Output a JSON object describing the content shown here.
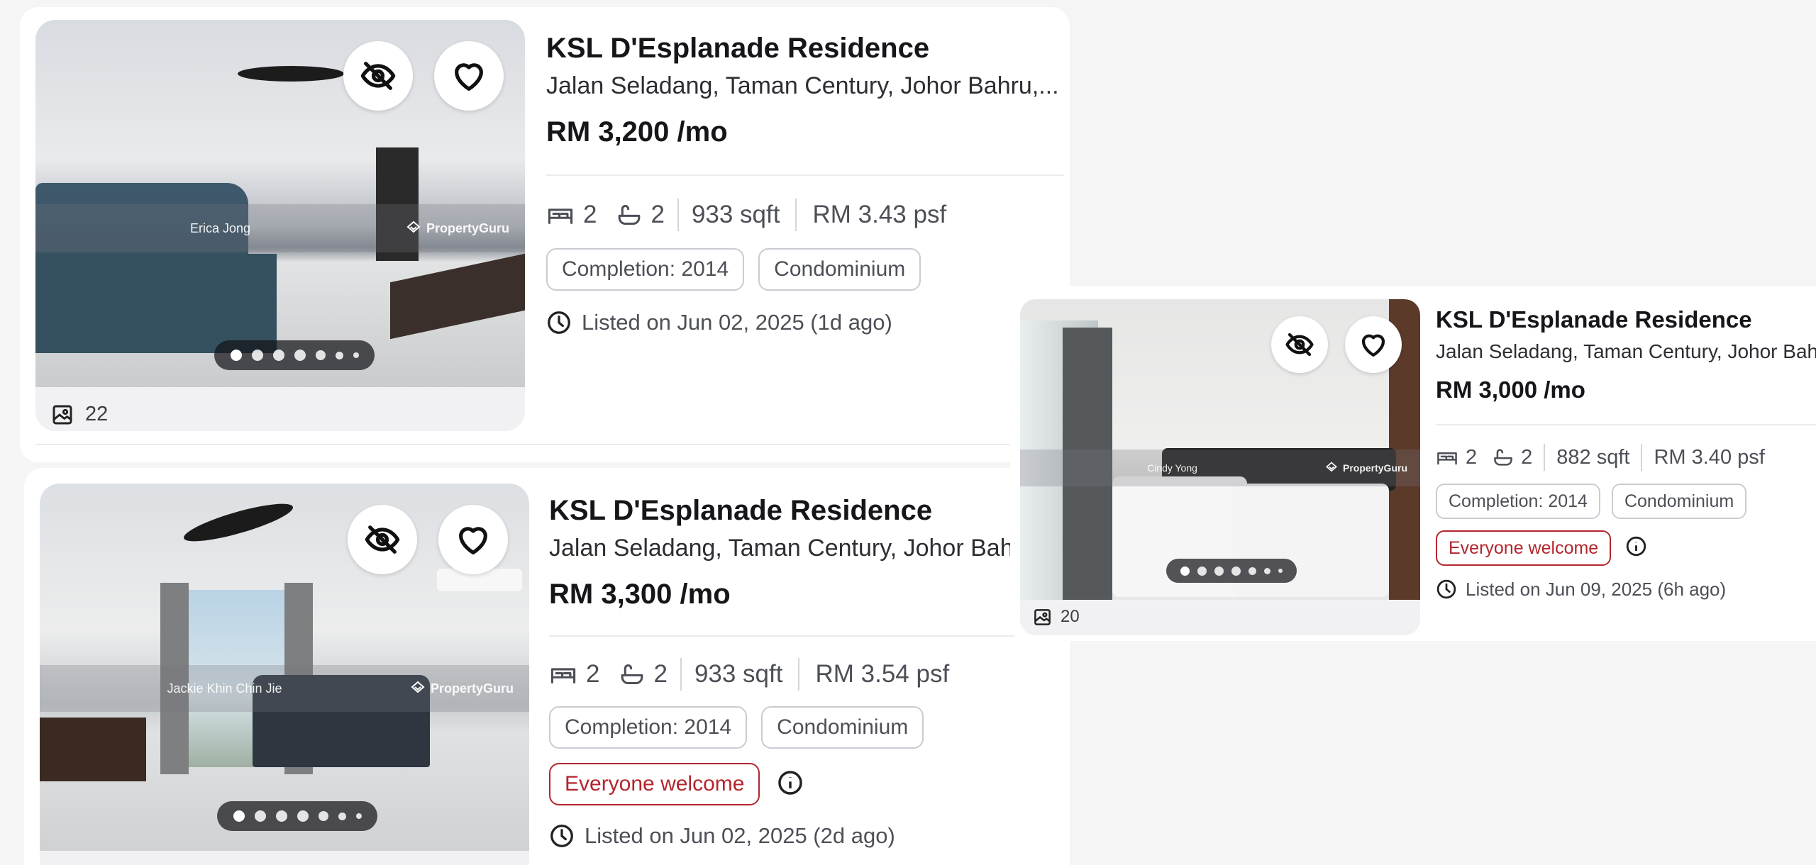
{
  "colors": {
    "accent_red": "#b3262d",
    "chip_border": "#c9ccd2",
    "text_muted": "#4d4f57"
  },
  "listings": [
    {
      "title": "KSL D'Esplanade Residence",
      "address": "Jalan Seladang, Taman Century, Johor Bahru,...",
      "price": "RM 3,200 /mo",
      "beds": "2",
      "baths": "2",
      "area": "933 sqft",
      "psf": "RM 3.43 psf",
      "completion": "Completion: 2014",
      "type": "Condominium",
      "listed": "Listed on Jun 02, 2025 (1d ago)",
      "photo_count": "22",
      "agent": "Erica Jong",
      "brand": "PropertyGuru",
      "icons": [
        "hide-icon",
        "heart-icon",
        "bed-icon",
        "bath-icon",
        "clock-icon",
        "gallery-icon"
      ]
    },
    {
      "title": "KSL D'Esplanade Residence",
      "address": "Jalan Seladang, Taman Century, Johor Bahru,...",
      "price": "RM 3,300 /mo",
      "beds": "2",
      "baths": "2",
      "area": "933 sqft",
      "psf": "RM 3.54 psf",
      "completion": "Completion: 2014",
      "type": "Condominium",
      "badge": "Everyone welcome",
      "listed": "Listed on Jun 02, 2025 (2d ago)",
      "agent": "Jackie Khin Chin Jie",
      "brand": "PropertyGuru",
      "icons": [
        "hide-icon",
        "heart-icon",
        "bed-icon",
        "bath-icon",
        "info-icon",
        "clock-icon"
      ]
    },
    {
      "title": "KSL D'Esplanade Residence",
      "address": "Jalan Seladang, Taman Century, Johor Bahru,...",
      "price": "RM 3,000 /mo",
      "beds": "2",
      "baths": "2",
      "area": "882 sqft",
      "psf": "RM 3.40 psf",
      "completion": "Completion: 2014",
      "type": "Condominium",
      "badge": "Everyone welcome",
      "listed": "Listed on Jun 09, 2025 (6h ago)",
      "photo_count": "20",
      "agent": "Cindy Yong",
      "brand": "PropertyGuru",
      "icons": [
        "hide-icon",
        "heart-icon",
        "bed-icon",
        "bath-icon",
        "info-icon",
        "clock-icon",
        "gallery-icon"
      ]
    }
  ]
}
